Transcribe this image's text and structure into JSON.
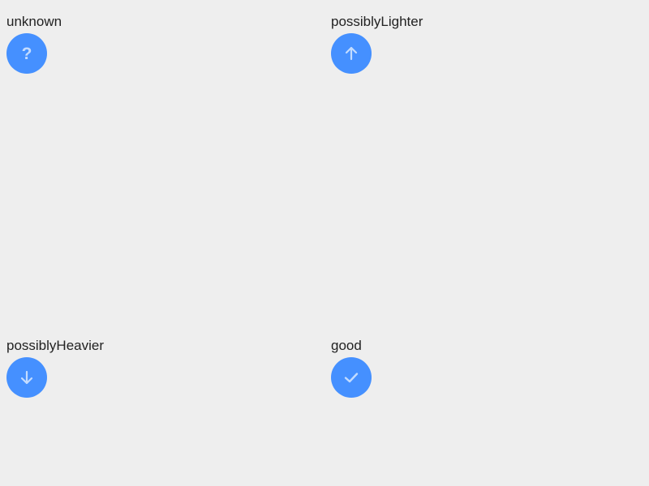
{
  "theme": {
    "button_color": "#4590ff",
    "icon_color": "#c3dcff"
  },
  "items": [
    {
      "label": "unknown",
      "icon": "question-icon"
    },
    {
      "label": "possiblyLighter",
      "icon": "arrow-up-icon"
    },
    {
      "label": "possiblyHeavier",
      "icon": "arrow-down-icon"
    },
    {
      "label": "good",
      "icon": "check-icon"
    }
  ]
}
